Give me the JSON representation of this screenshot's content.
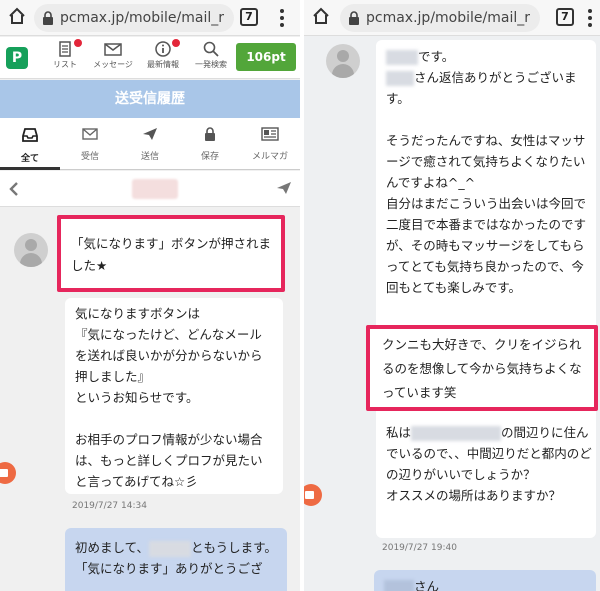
{
  "browser_left": {
    "url": "pcmax.jp/mobile/mail_r",
    "tab_count": "7"
  },
  "browser_right": {
    "url": "pcmax.jp/mobile/mail_r",
    "tab_count": "7"
  },
  "appnav": {
    "logo": "P",
    "items": [
      {
        "label": "リスト",
        "icon": "list-icon"
      },
      {
        "label": "メッセージ",
        "icon": "mail-icon"
      },
      {
        "label": "最新情報",
        "icon": "info-icon"
      },
      {
        "label": "一発検索",
        "icon": "search-icon"
      }
    ],
    "points": "106pt"
  },
  "header": {
    "title": "送受信履歴"
  },
  "tabs": [
    {
      "label": "全て",
      "icon": "inbox-icon"
    },
    {
      "label": "受信",
      "icon": "envelope-icon"
    },
    {
      "label": "送信",
      "icon": "paper-plane-icon"
    },
    {
      "label": "保存",
      "icon": "lock-icon"
    },
    {
      "label": "メルマガ",
      "icon": "newspaper-icon"
    }
  ],
  "left_messages": {
    "highlight": "「気になります」ボタンが押されました★",
    "body": "気になりますボタンは\n『気になったけど、どんなメールを送れば良いかが分からないから押しました』\nというお知らせです。\n\nお相手のプロフ情報が少ない場合は、もっと詳しくプロフが見たいと言ってあげてね☆彡",
    "timestamp": "2019/7/27 14:34",
    "sent_line1_prefix": "初めまして、",
    "sent_line1_suffix": "ともうします。",
    "sent_line2": "「気になります」ありがとうござ"
  },
  "right_messages": {
    "line1_suffix": "です。",
    "line2_suffix": "さん返信ありがとうございます。",
    "para1": "そうだったんですね、女性はマッサージで癒されて気持ちよくなりたいんですよね^_^\n自分はまだこういう出会いは今回で二度目で本番まではなかったのですが、その時もマッサージをしてもらってとても気持ち良かったので、今回もとても楽しみです。",
    "highlight": "クンニも大好きで、クリをイジられるのを想像して今から気持ちよくなっています笑",
    "para2_prefix": "私は",
    "para2_suffix": "の間辺りに住んでいるので、、中間辺りだと都内のどの辺りがいいでしょうか？\nオススメの場所はありますか？",
    "timestamp": "2019/7/27 19:40",
    "next_suffix": "さん"
  },
  "colors": {
    "highlight": "#e6265c",
    "header": "#a9c6e8",
    "points_button": "#52a63a",
    "logo": "#16a05a"
  }
}
